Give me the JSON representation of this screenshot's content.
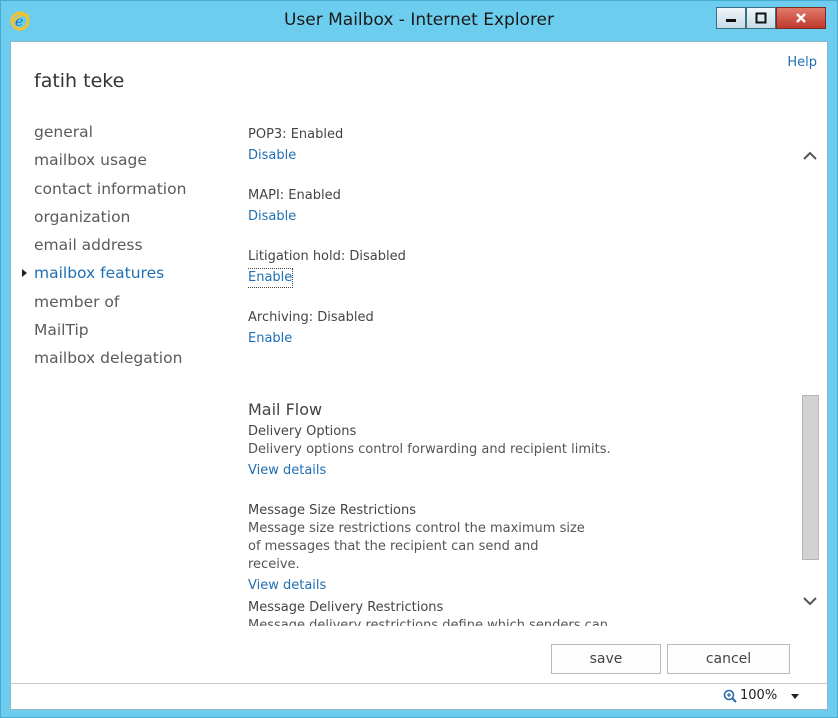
{
  "window": {
    "title": "User Mailbox - Internet Explorer",
    "app_icon": "internet-explorer-icon",
    "title_bar_color": "#6ccdee"
  },
  "header": {
    "help": "Help",
    "user_name": "fatih teke"
  },
  "nav": {
    "items": [
      {
        "label": "general"
      },
      {
        "label": "mailbox usage"
      },
      {
        "label": "contact information"
      },
      {
        "label": "organization"
      },
      {
        "label": "email address"
      },
      {
        "label": "mailbox features",
        "active": true
      },
      {
        "label": "member of"
      },
      {
        "label": "MailTip"
      },
      {
        "label": "mailbox delegation"
      }
    ]
  },
  "features": [
    {
      "label": "POP3: Enabled",
      "action": "Disable"
    },
    {
      "label": "MAPI: Enabled",
      "action": "Disable"
    },
    {
      "label": "Litigation hold: Disabled",
      "action": "Enable"
    },
    {
      "label": "Archiving: Disabled",
      "action": "Enable"
    }
  ],
  "mail_flow": {
    "title": "Mail Flow",
    "blocks": [
      {
        "title": "Delivery Options",
        "description": "Delivery options control forwarding and recipient limits.",
        "link": "View details"
      },
      {
        "title": "Message Size Restrictions",
        "description": "Message size restrictions control the maximum size of messages that the recipient can send and receive.",
        "link": "View details"
      },
      {
        "title": "Message Delivery Restrictions",
        "description": "Message delivery restrictions define which senders can"
      }
    ]
  },
  "buttons": {
    "save": "save",
    "cancel": "cancel"
  },
  "status": {
    "zoom": "100%"
  },
  "colors": {
    "link": "#1f6fb2",
    "active_nav": "#1f6fb2"
  }
}
